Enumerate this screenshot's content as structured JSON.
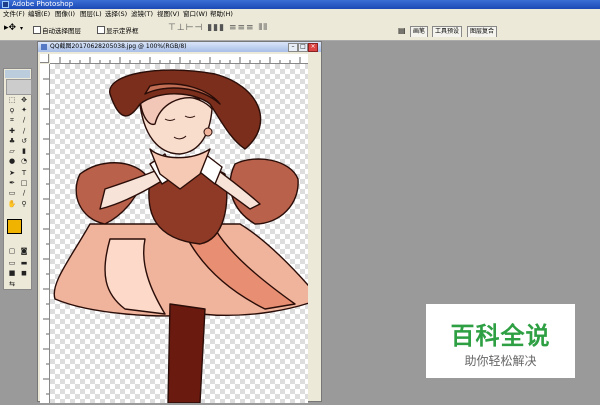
{
  "window": {
    "title": "Adobe Photoshop"
  },
  "menu": [
    "文件(F)",
    "编辑(E)",
    "图像(I)",
    "图层(L)",
    "选择(S)",
    "滤镜(T)",
    "视图(V)",
    "窗口(W)",
    "帮助(H)"
  ],
  "options": {
    "auto_select_label": "自动选择图层",
    "show_bounds_label": "显示定界框"
  },
  "palette_tabs": [
    "画笔",
    "工具预设",
    "图层复合"
  ],
  "document": {
    "title": "QQ截图20170628205038.jpg @ 100%(RGB/8)"
  },
  "colors": {
    "foreground": "#f0b400",
    "background": "#ffffff"
  },
  "watermark": {
    "title": "百科全说",
    "subtitle": "助你轻松解决"
  }
}
